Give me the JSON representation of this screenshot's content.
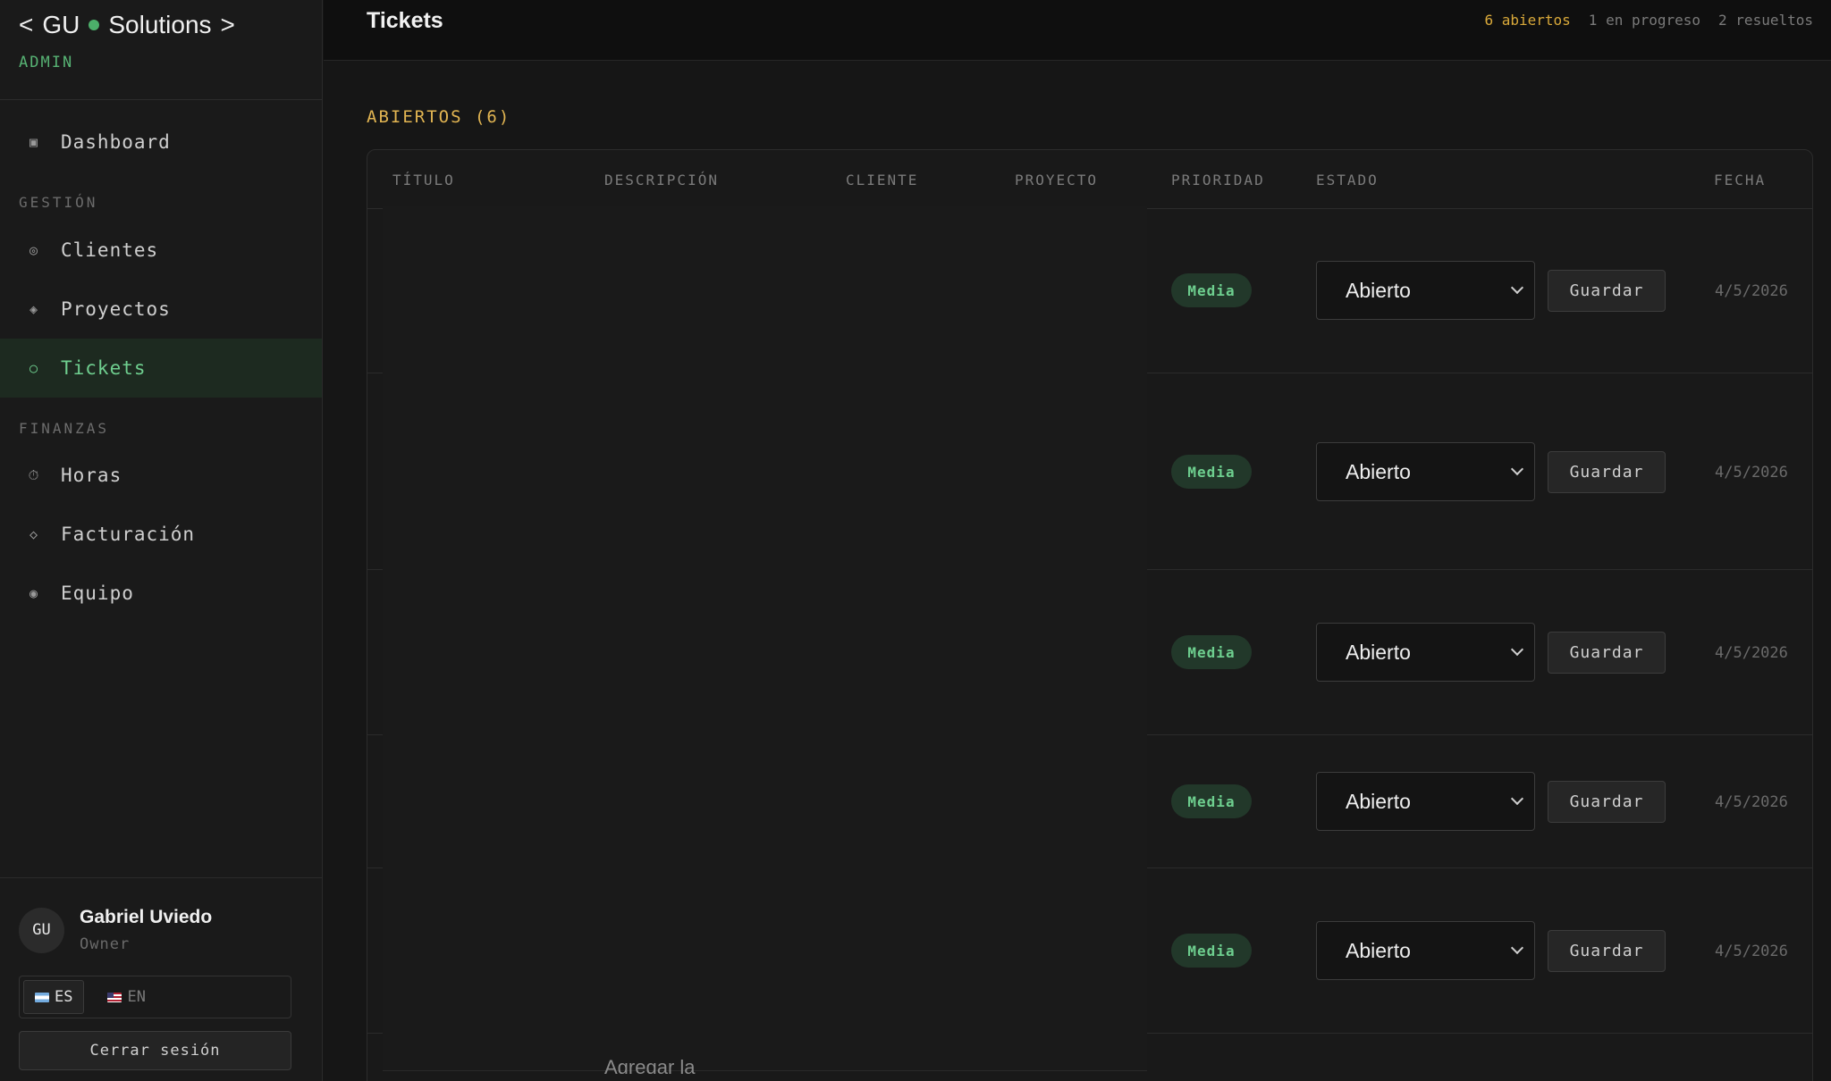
{
  "brand": {
    "left": "<",
    "name_a": "GU",
    "name_b": "Solutions",
    "right": ">",
    "role": "ADMIN"
  },
  "nav": {
    "dashboard": {
      "icon": "square-icon",
      "glyph": "▣",
      "label": "Dashboard"
    },
    "section_gestion": "GESTIÓN",
    "clientes": {
      "icon": "circle-dot-icon",
      "glyph": "◎",
      "label": "Clientes"
    },
    "proyectos": {
      "icon": "diamond-icon",
      "glyph": "◈",
      "label": "Proyectos"
    },
    "tickets": {
      "icon": "circle-icon",
      "glyph": "○",
      "label": "Tickets"
    },
    "section_finanzas": "FINANZAS",
    "horas": {
      "icon": "clock-icon",
      "glyph": "⏱",
      "label": "Horas"
    },
    "facturacion": {
      "icon": "diamond-outline-icon",
      "glyph": "◇",
      "label": "Facturación"
    },
    "equipo": {
      "icon": "circle-filled-icon",
      "glyph": "◉",
      "label": "Equipo"
    }
  },
  "user": {
    "initials": "GU",
    "name": "Gabriel Uviedo",
    "role": "Owner"
  },
  "language": {
    "es": "ES",
    "en": "EN",
    "selected": "ES"
  },
  "logout_label": "Cerrar sesión",
  "header": {
    "title": "Tickets",
    "stats": {
      "open": "6 abiertos",
      "in_progress": "1 en progreso",
      "resolved": "2 resueltos"
    }
  },
  "group": {
    "label": "ABIERTOS (6)"
  },
  "table": {
    "columns": [
      "TÍTULO",
      "DESCRIPCIÓN",
      "CLIENTE",
      "PROYECTO",
      "PRIORIDAD",
      "ESTADO",
      "FECHA"
    ],
    "rows": [
      {
        "priority": "Media",
        "status": "Abierto",
        "action": "Guardar",
        "date": "4/5/2026"
      },
      {
        "priority": "Media",
        "status": "Abierto",
        "action": "Guardar",
        "date": "4/5/2026"
      },
      {
        "priority": "Media",
        "status": "Abierto",
        "action": "Guardar",
        "date": "4/5/2026"
      },
      {
        "priority": "Media",
        "status": "Abierto",
        "action": "Guardar",
        "date": "4/5/2026"
      },
      {
        "priority": "Media",
        "status": "Abierto",
        "action": "Guardar",
        "date": "4/5/2026"
      }
    ],
    "partial_text": "Agregar la"
  },
  "colors": {
    "accent_green": "#6fcf8f",
    "accent_yellow": "#e2b552",
    "background": "#161616"
  }
}
